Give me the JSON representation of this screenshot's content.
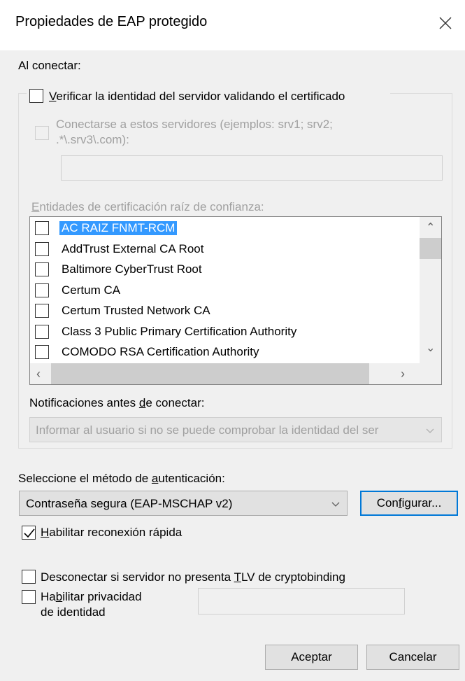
{
  "window": {
    "title": "Propiedades de EAP protegido",
    "close_icon": "close-icon"
  },
  "connect_section": {
    "heading": "Al conectar:",
    "verify_server_label_prefix": "",
    "verify_server_label_u": "V",
    "verify_server_label_rest": "erificar la identidad del servidor validando el certificado",
    "verify_server_checked": false,
    "connect_servers_label_line1": "Conectarse a estos servidores (ejemplos: srv1; srv2;",
    "connect_servers_label_line2": ".*\\.srv3\\.com):",
    "connect_servers_value": "",
    "root_ca_label_u": "E",
    "root_ca_label_rest": "ntidades de certificación raíz de confianza:",
    "root_ca_items": [
      {
        "name": "AC RAIZ FNMT-RCM",
        "checked": false,
        "selected": true
      },
      {
        "name": "AddTrust External CA Root",
        "checked": false,
        "selected": false
      },
      {
        "name": "Baltimore CyberTrust Root",
        "checked": false,
        "selected": false
      },
      {
        "name": "Certum CA",
        "checked": false,
        "selected": false
      },
      {
        "name": "Certum Trusted Network CA",
        "checked": false,
        "selected": false
      },
      {
        "name": "Class 3 Public Primary Certification Authority",
        "checked": false,
        "selected": false
      },
      {
        "name": "COMODO RSA Certification Authority",
        "checked": false,
        "selected": false
      }
    ],
    "notifications_label_a": "Notificaciones antes ",
    "notifications_label_u": "d",
    "notifications_label_b": "e conectar:",
    "notifications_value": "Informar al usuario si no se puede comprobar la identidad del ser"
  },
  "auth": {
    "label_a": "Seleccione el método de ",
    "label_u": "a",
    "label_b": "utenticación:",
    "method_value": "Contraseña segura (EAP-MSCHAP v2)",
    "configure_a": "Con",
    "configure_u": "f",
    "configure_b": "igurar...",
    "fast_reconnect_u": "H",
    "fast_reconnect_rest": "abilitar reconexión rápida",
    "fast_reconnect_checked": true
  },
  "options": {
    "disconnect_a": "Desconectar si servidor no presenta ",
    "disconnect_u": "T",
    "disconnect_b": "LV de cryptobinding",
    "disconnect_checked": false,
    "privacy_line1_a": "Ha",
    "privacy_line1_u": "b",
    "privacy_line1_b": "ilitar privacidad",
    "privacy_line2": "de identidad",
    "privacy_checked": false,
    "privacy_value": ""
  },
  "buttons": {
    "ok": "Aceptar",
    "cancel": "Cancelar"
  },
  "colors": {
    "selection": "#3399ff",
    "focus_border": "#0078d7",
    "disabled_text": "#a0a0a0"
  }
}
